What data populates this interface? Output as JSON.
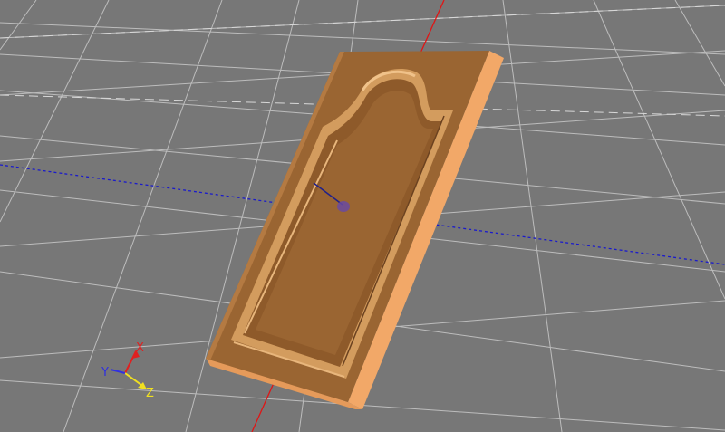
{
  "viewport": {
    "background": "#777777",
    "grid_color": "#c9c9c9",
    "axis_x_color": "#e01515",
    "axis_z_color": "#1a1acc"
  },
  "model": {
    "wood_top": "#9a6532",
    "wood_side": "#f2a868",
    "wood_highlight": "#e5b27a",
    "wood_shadow": "#6b4220",
    "origin_marker_color": "#6a4aa0",
    "origin_marker_line": "#20208a"
  },
  "triad": {
    "x_label": "X",
    "y_label": "Y",
    "z_label": "Z",
    "x_color": "#e02020",
    "y_color": "#3030e0",
    "z_color": "#f0e020"
  }
}
